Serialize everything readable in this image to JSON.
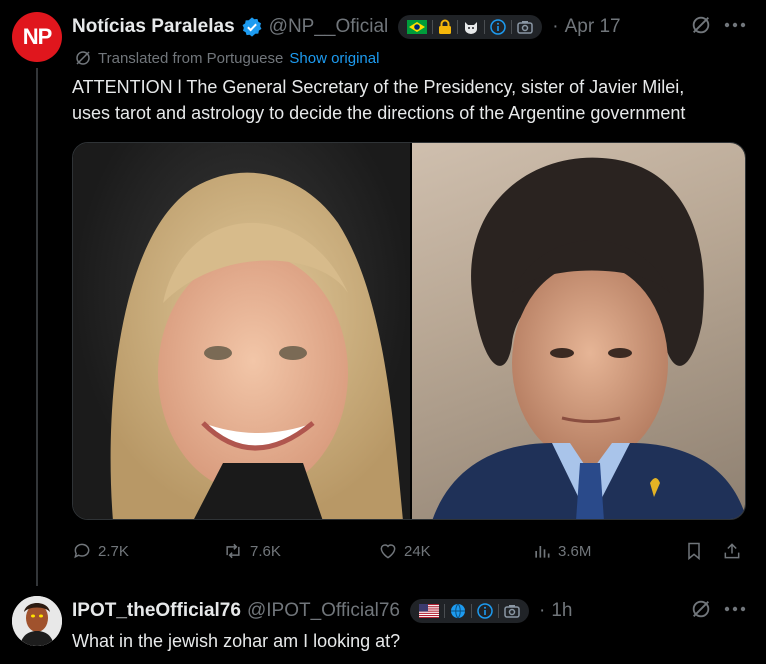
{
  "post": {
    "avatar_text": "NP",
    "display_name": "Notícias Paralelas",
    "handle": "@NP__Oficial",
    "time": "Apr 17",
    "translated_label": "Translated from Portuguese",
    "show_original": "Show original",
    "text_line1": "ATTENTION l The General Secretary of the Presidency, sister of Javier Milei,",
    "text_line2": "uses tarot and astrology to decide the directions of the Argentine government",
    "stats": {
      "replies": "2.7K",
      "reposts": "7.6K",
      "likes": "24K",
      "views": "3.6M"
    },
    "badges": [
      "brazil-flag",
      "lock-icon",
      "cat-icon",
      "info-icon",
      "camera-icon"
    ]
  },
  "reply": {
    "display_name": "IPOT_theOfficial76",
    "handle": "@IPOT_Official76",
    "time": "1h",
    "text": "What in the jewish zohar am I looking at?",
    "badges": [
      "us-flag",
      "globe-icon",
      "info-icon",
      "camera-icon"
    ]
  },
  "colors": {
    "background": "#000000",
    "text": "#e7e9ea",
    "muted": "#71767b",
    "link": "#1d9bf0",
    "verified": "#1d9bf0",
    "np_red": "#e0161d"
  }
}
